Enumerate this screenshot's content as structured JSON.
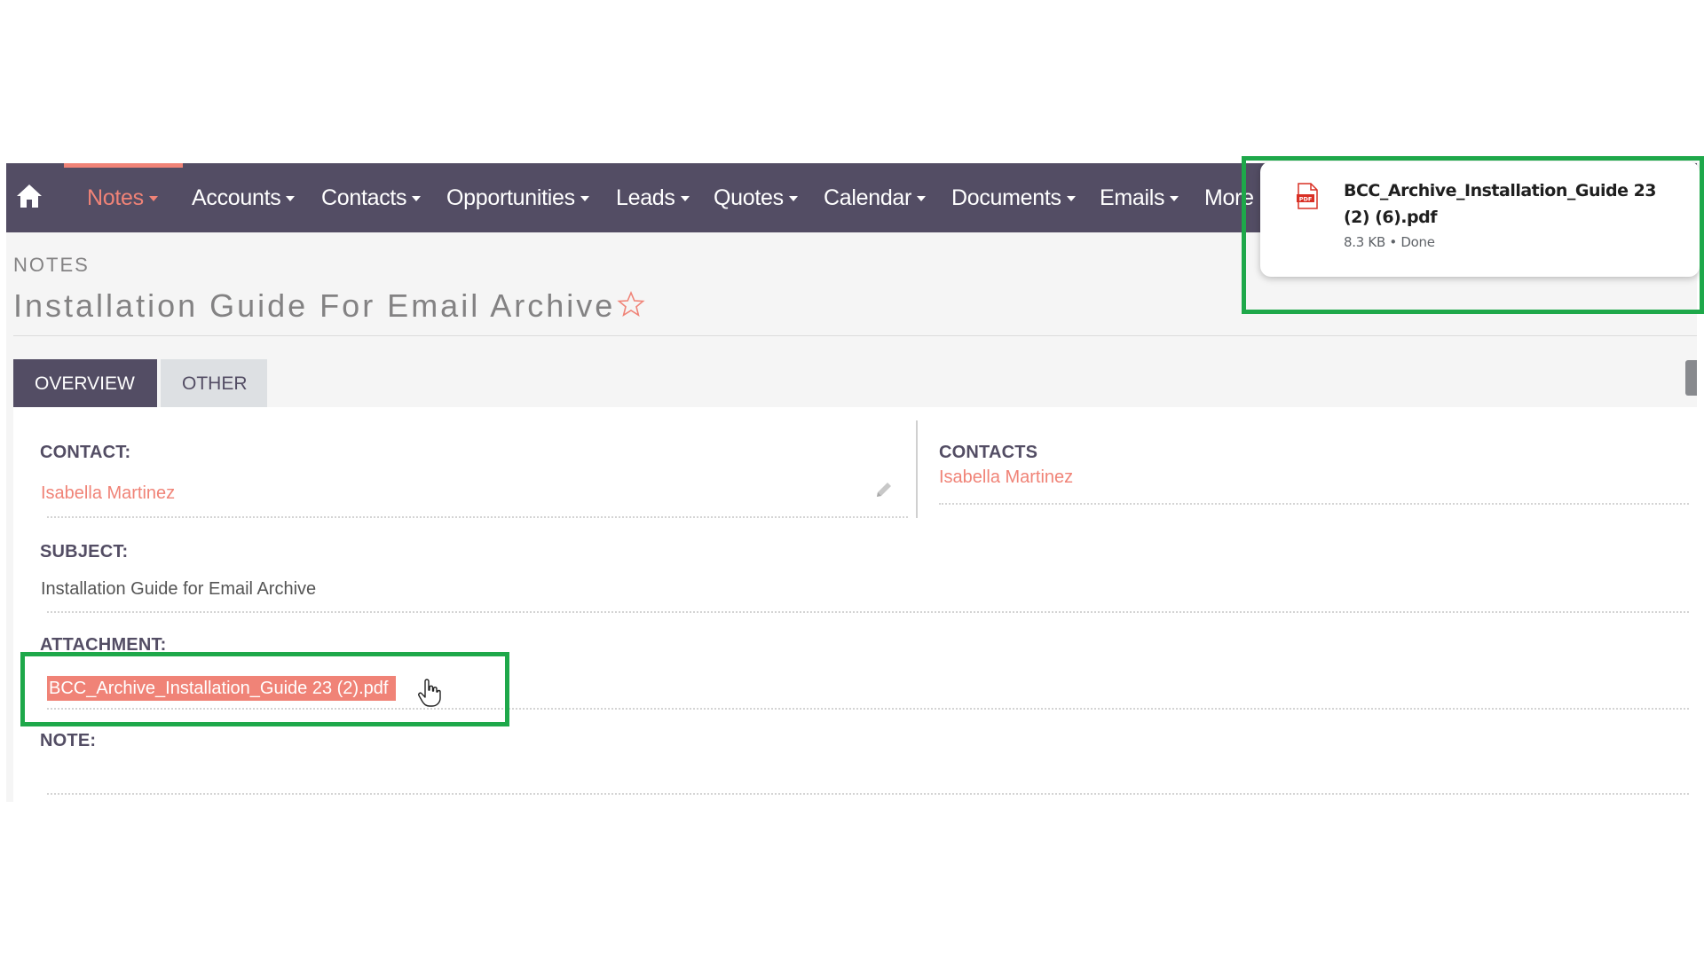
{
  "nav": {
    "items": [
      {
        "label": "Notes",
        "active": true
      },
      {
        "label": "Accounts"
      },
      {
        "label": "Contacts"
      },
      {
        "label": "Opportunities"
      },
      {
        "label": "Leads"
      },
      {
        "label": "Quotes"
      },
      {
        "label": "Calendar"
      },
      {
        "label": "Documents"
      },
      {
        "label": "Emails"
      },
      {
        "label": "More"
      }
    ],
    "home_icon": "home-icon"
  },
  "header": {
    "module": "NOTES",
    "title": "Installation Guide For Email Archive",
    "favorite_icon": "star-outline-icon"
  },
  "tabs": [
    {
      "label": "OVERVIEW",
      "active": true
    },
    {
      "label": "OTHER"
    }
  ],
  "fields": {
    "contact_label": "CONTACT:",
    "contact_value": "Isabella Martinez",
    "contacts_label": "CONTACTS",
    "contacts_value": "Isabella Martinez",
    "subject_label": "SUBJECT:",
    "subject_value": "Installation Guide for Email Archive",
    "attachment_label": "ATTACHMENT:",
    "attachment_value": "BCC_Archive_Installation_Guide 23 (2).pdf",
    "note_label": "NOTE:"
  },
  "download": {
    "filename": "BCC_Archive_Installation_Guide 23 (2) (6).pdf",
    "status": "8.3 KB • Done",
    "icon": "pdf-file-icon"
  },
  "colors": {
    "nav_bg": "#534d64",
    "accent": "#f08377",
    "highlight": "#1ea84a"
  }
}
